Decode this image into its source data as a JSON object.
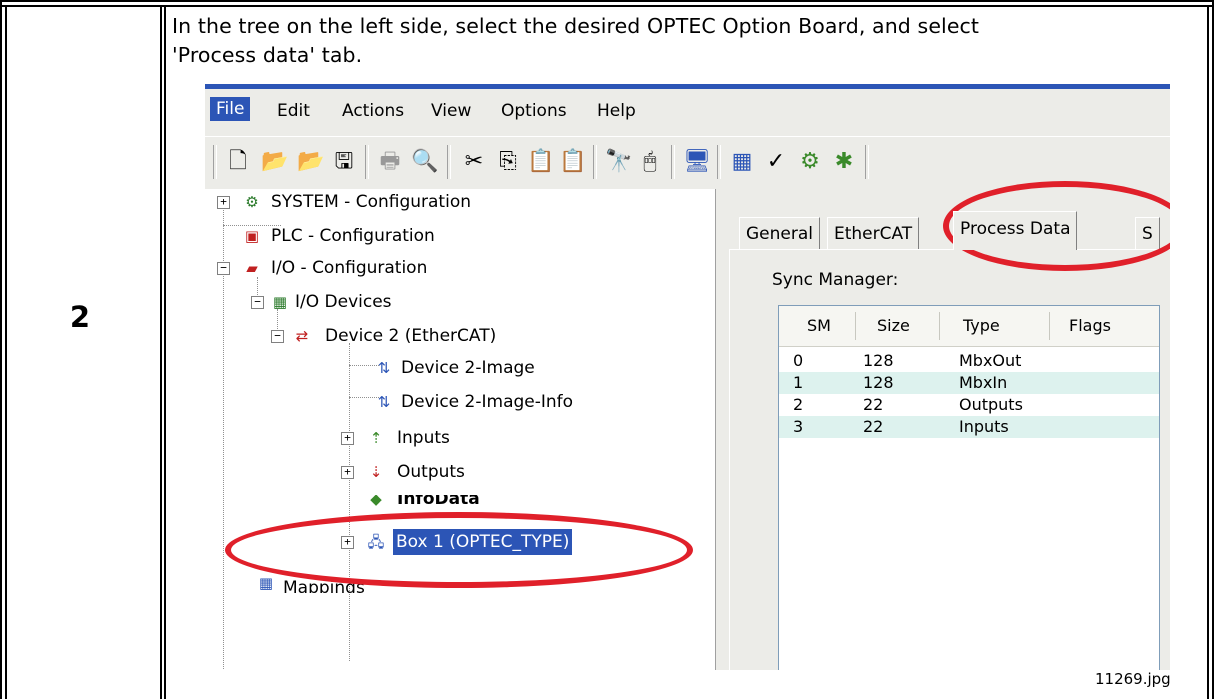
{
  "step": {
    "number": "2"
  },
  "instruction": {
    "line1": "In the tree on the left side, select the desired OPTEC Option Board, and select",
    "line2": "'Process data' tab."
  },
  "screenshot": {
    "menu": [
      "File",
      "Edit",
      "Actions",
      "View",
      "Options",
      "Help"
    ],
    "toolbar_icons": [
      "new-file-icon",
      "open-folder-icon",
      "open-folder-alt-icon",
      "save-icon",
      "print-icon",
      "print-preview-icon",
      "cut-icon",
      "copy-icon",
      "paste-icon",
      "paste-alt-icon",
      "find-icon",
      "mouse-icon",
      "monitor-icon",
      "mappings-icon",
      "check-icon",
      "build-icon",
      "activate-icon"
    ],
    "tree": {
      "system": "SYSTEM - Configuration",
      "plc": "PLC - Configuration",
      "io": "I/O - Configuration",
      "io_devices": "I/O Devices",
      "device2": "Device 2 (EtherCAT)",
      "device2_image": "Device 2-Image",
      "device2_image_info": "Device 2-Image-Info",
      "inputs": "Inputs",
      "outputs": "Outputs",
      "infodata": "InfoData",
      "box1": "Box 1 (OPTEC_TYPE)",
      "mappings": "Mappings"
    },
    "tabs": [
      "General",
      "EtherCAT",
      "Process Data",
      "S"
    ],
    "active_tab": "Process Data",
    "sync_manager_label": "Sync Manager:",
    "grid": {
      "headers": [
        "SM",
        "Size",
        "Type",
        "Flags"
      ],
      "rows": [
        [
          "0",
          "128",
          "MbxOut",
          ""
        ],
        [
          "1",
          "128",
          "MbxIn",
          ""
        ],
        [
          "2",
          "22",
          "Outputs",
          ""
        ],
        [
          "3",
          "22",
          "Inputs",
          ""
        ]
      ]
    }
  },
  "caption": "11269.jpg",
  "colors": {
    "highlight": "#e0202a",
    "selection": "#2c55b6",
    "alt_row": "#ddf2ee"
  }
}
